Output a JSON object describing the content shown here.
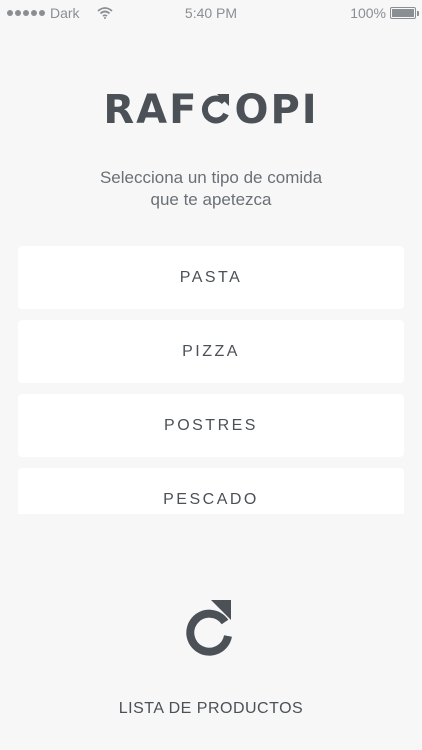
{
  "status_bar": {
    "carrier": "Dark",
    "time": "5:40 PM",
    "battery": "100%",
    "signal_icon": "signal-dots-icon",
    "wifi_icon": "wifi-icon",
    "battery_icon": "battery-icon"
  },
  "logo": {
    "left": "RAF",
    "right": "OPI",
    "middle_icon": "refresh-arrow-o-icon"
  },
  "subtitle": {
    "line1": "Selecciona un tipo de comida",
    "line2": "que te apetezca"
  },
  "food_types": [
    {
      "label": "PASTA"
    },
    {
      "label": "PIZZA"
    },
    {
      "label": "POSTRES"
    },
    {
      "label": "PESCADO"
    }
  ],
  "refresh": {
    "icon": "refresh-icon"
  },
  "footer": {
    "products_label": "LISTA DE PRODUCTOS"
  },
  "colors": {
    "text": "#4b5157",
    "background": "#f7f7f7",
    "card": "#ffffff"
  }
}
